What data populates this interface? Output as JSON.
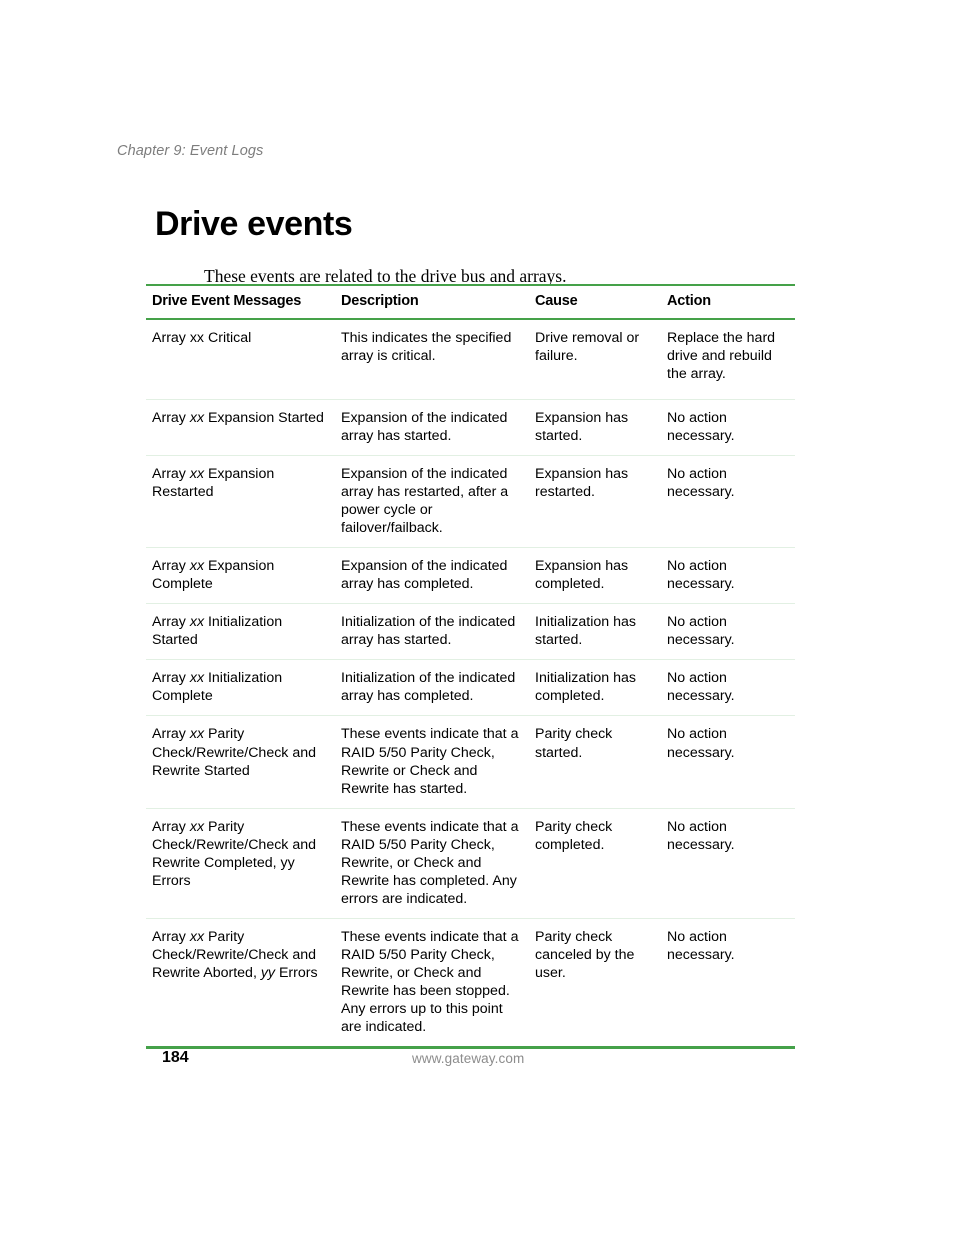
{
  "header": {
    "chapter": "Chapter 9: Event Logs"
  },
  "page_title": "Drive events",
  "intro": "These events are related to the drive bus and arrays.",
  "colors": {
    "rule_green": "#45a149",
    "row_rule": "#e2f0e3",
    "header_gray": "#7d7d7d",
    "footer_gray": "#8c8c8c"
  },
  "table": {
    "columns": [
      "Drive Event Messages",
      "Description",
      "Cause",
      "Action"
    ],
    "rows": [
      {
        "message_pre": "Array xx Critical",
        "message_var": "",
        "message_post": "",
        "description": "This indicates the specified array is critical.",
        "cause": "Drive removal or failure.",
        "action": "Replace the hard drive and rebuild the array."
      },
      {
        "message_pre": "Array ",
        "message_var": "xx",
        "message_post": " Expansion Started",
        "description": "Expansion of the indicated array has started.",
        "cause": "Expansion has started.",
        "action": "No action necessary."
      },
      {
        "message_pre": "Array ",
        "message_var": "xx",
        "message_post": " Expansion Restarted",
        "description": "Expansion of the indicated array has restarted, after a power cycle or failover/failback.",
        "cause": "Expansion has restarted.",
        "action": "No action necessary."
      },
      {
        "message_pre": "Array ",
        "message_var": "xx",
        "message_post": " Expansion Complete",
        "description": "Expansion of the indicated array has completed.",
        "cause": "Expansion has completed.",
        "action": "No action necessary."
      },
      {
        "message_pre": "Array ",
        "message_var": "xx",
        "message_post": " Initialization Started",
        "description": "Initialization of the indicated array has started.",
        "cause": "Initialization has started.",
        "action": "No action necessary."
      },
      {
        "message_pre": "Array ",
        "message_var": "xx",
        "message_post": " Initialization Complete",
        "description": "Initialization of the indicated array has completed.",
        "cause": "Initialization has completed.",
        "action": "No action necessary."
      },
      {
        "message_pre": "Array ",
        "message_var": "xx",
        "message_post": " Parity Check/Rewrite/Check and Rewrite Started",
        "description": "These events indicate that a RAID 5/50 Parity Check, Rewrite or Check and Rewrite has started.",
        "cause": "Parity check started.",
        "action": "No action necessary."
      },
      {
        "message_pre": "Array ",
        "message_var": "xx",
        "message_post": " Parity Check/Rewrite/Check and Rewrite Completed, yy Errors",
        "description": "These events indicate that a RAID 5/50 Parity Check, Rewrite, or Check and Rewrite has completed. Any errors are indicated.",
        "cause": "Parity check completed.",
        "action": "No action necessary."
      },
      {
        "message_pre": "Array ",
        "message_var": "xx",
        "message_post": " Parity Check/Rewrite/Check and Rewrite Aborted, ",
        "message_var2": "yy",
        "message_post2": " Errors",
        "description": "These events indicate that a RAID 5/50 Parity Check, Rewrite, or Check and Rewrite has been stopped. Any errors up to this point are indicated.",
        "cause": "Parity check canceled by the user.",
        "action": "No action necessary."
      }
    ]
  },
  "footer": {
    "page_number": "184",
    "url": "www.gateway.com"
  }
}
